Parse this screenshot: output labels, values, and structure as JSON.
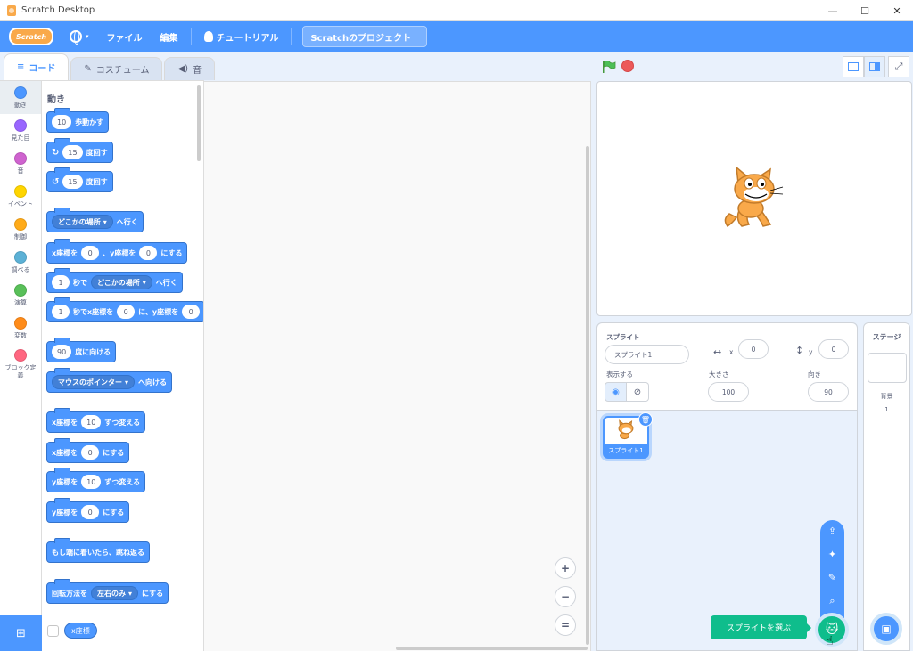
{
  "window": {
    "title": "Scratch Desktop",
    "minimize": "—",
    "maximize": "☐",
    "close": "✕"
  },
  "menubar": {
    "logo": "Scratch",
    "file": "ファイル",
    "edit": "編集",
    "tutorials": "チュートリアル",
    "project_title": "Scratchのプロジェクト",
    "caret": "▾"
  },
  "tabs": {
    "code": "コード",
    "costumes": "コスチューム",
    "sounds": "音"
  },
  "categories": [
    {
      "label": "動き",
      "color": "#4c97ff"
    },
    {
      "label": "見た目",
      "color": "#9966ff"
    },
    {
      "label": "音",
      "color": "#cf63cf"
    },
    {
      "label": "イベント",
      "color": "#ffd500"
    },
    {
      "label": "制御",
      "color": "#ffab19"
    },
    {
      "label": "調べる",
      "color": "#5cb1d6"
    },
    {
      "label": "演算",
      "color": "#59c059"
    },
    {
      "label": "変数",
      "color": "#ff8c1a"
    },
    {
      "label": "ブロック定義",
      "color": "#ff6680"
    }
  ],
  "palette": {
    "title": "動き",
    "move": {
      "value": "10",
      "text": "歩動かす"
    },
    "turn_right": {
      "icon": "↻",
      "value": "15",
      "text": "度回す"
    },
    "turn_left": {
      "icon": "↺",
      "value": "15",
      "text": "度回す"
    },
    "goto": {
      "dropdown": "どこかの場所",
      "text": "へ行く"
    },
    "goto_xy": {
      "t1": "x座標を",
      "x": "0",
      "t2": "、y座標を",
      "y": "0",
      "t3": "にする"
    },
    "glide": {
      "value": "1",
      "t1": "秒で",
      "dropdown": "どこかの場所",
      "t2": "へ行く"
    },
    "glide_xy": {
      "value": "1",
      "t1": "秒でx座標を",
      "x": "0",
      "t2": "に、y座標を",
      "y": "0"
    },
    "point_dir": {
      "value": "90",
      "text": "度に向ける"
    },
    "point_towards": {
      "dropdown": "マウスのポインター",
      "text": "へ向ける"
    },
    "change_x": {
      "t1": "x座標を",
      "value": "10",
      "t2": "ずつ変える"
    },
    "set_x": {
      "t1": "x座標を",
      "value": "0",
      "t2": "にする"
    },
    "change_y": {
      "t1": "y座標を",
      "value": "10",
      "t2": "ずつ変える"
    },
    "set_y": {
      "t1": "y座標を",
      "value": "0",
      "t2": "にする"
    },
    "bounce": "もし端に着いたら、跳ね返る",
    "rotation": {
      "t1": "回転方法を",
      "dropdown": "左右のみ",
      "t2": "にする"
    },
    "x_reporter": "x座標"
  },
  "zoom": {
    "in": "+",
    "out": "−",
    "reset": "="
  },
  "sprite_info": {
    "sprite_label": "スプライト",
    "sprite_name": "スプライト1",
    "x_label": "x",
    "x_value": "0",
    "y_label": "y",
    "y_value": "0",
    "show_label": "表示する",
    "size_label": "大きさ",
    "size_value": "100",
    "direction_label": "向き",
    "direction_value": "90"
  },
  "sprite_list": [
    {
      "name": "スプライト1"
    }
  ],
  "stage_panel": {
    "title": "ステージ",
    "backdrop_label": "背景",
    "backdrop_count": "1"
  },
  "add_sprite": {
    "tooltip": "スプライトを選ぶ"
  },
  "colors": {
    "motion": "#4c97ff",
    "accent_green": "#0fbd8c",
    "stop_red": "#ec5959",
    "flag_green": "#4cbf56"
  }
}
